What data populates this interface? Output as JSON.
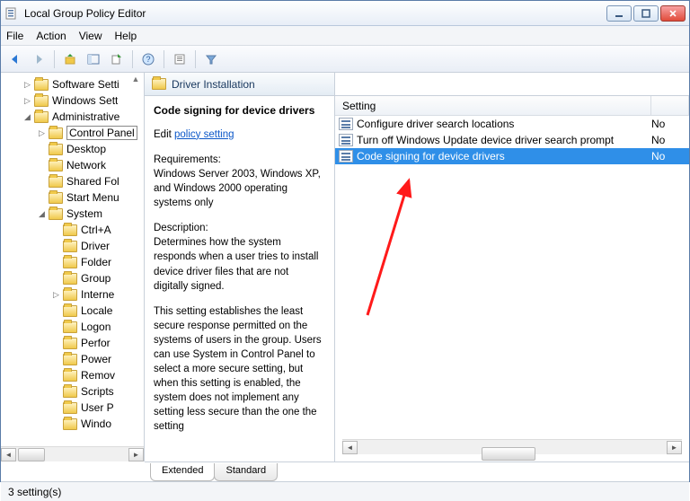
{
  "window": {
    "title": "Local Group Policy Editor"
  },
  "menu": {
    "file": "File",
    "action": "Action",
    "view": "View",
    "help": "Help"
  },
  "tree": {
    "items": [
      {
        "indent": 1,
        "exp": "▷",
        "label": "Software Setti"
      },
      {
        "indent": 1,
        "exp": "▷",
        "label": "Windows Sett"
      },
      {
        "indent": 1,
        "exp": "◢",
        "label": "Administrative"
      },
      {
        "indent": 2,
        "exp": "▷",
        "label": "Control Panel",
        "boxed": true
      },
      {
        "indent": 2,
        "exp": "",
        "label": "Desktop"
      },
      {
        "indent": 2,
        "exp": "",
        "label": "Network"
      },
      {
        "indent": 2,
        "exp": "",
        "label": "Shared Fol"
      },
      {
        "indent": 2,
        "exp": "",
        "label": "Start Menu"
      },
      {
        "indent": 2,
        "exp": "◢",
        "label": "System"
      },
      {
        "indent": 3,
        "exp": "",
        "label": "Ctrl+A"
      },
      {
        "indent": 3,
        "exp": "",
        "label": "Driver "
      },
      {
        "indent": 3,
        "exp": "",
        "label": "Folder"
      },
      {
        "indent": 3,
        "exp": "",
        "label": "Group"
      },
      {
        "indent": 3,
        "exp": "▷",
        "label": "Interne"
      },
      {
        "indent": 3,
        "exp": "",
        "label": "Locale"
      },
      {
        "indent": 3,
        "exp": "",
        "label": "Logon"
      },
      {
        "indent": 3,
        "exp": "",
        "label": "Perfor"
      },
      {
        "indent": 3,
        "exp": "",
        "label": "Power"
      },
      {
        "indent": 3,
        "exp": "",
        "label": "Remov"
      },
      {
        "indent": 3,
        "exp": "",
        "label": "Scripts"
      },
      {
        "indent": 3,
        "exp": "",
        "label": "User P"
      },
      {
        "indent": 3,
        "exp": "",
        "label": "Windo"
      }
    ]
  },
  "middle": {
    "folder_title": "Driver Installation",
    "setting_title": "Code signing for device drivers",
    "edit_prefix": "Edit ",
    "edit_link": "policy setting",
    "requirements_label": "Requirements:",
    "requirements_body": "Windows Server 2003, Windows XP, and Windows 2000 operating systems only",
    "description_label": "Description:",
    "description_body1": "Determines how the system responds when a user tries to install device driver files that are not digitally signed.",
    "description_body2": "This setting establishes the least secure response permitted on the systems of users in the group. Users can use System in Control Panel to select a more secure setting, but when this setting is enabled, the system does not implement any setting less secure than the one the setting"
  },
  "list": {
    "col_setting": "Setting",
    "rows": [
      {
        "label": "Configure driver search locations",
        "state": "No"
      },
      {
        "label": "Turn off Windows Update device driver search prompt",
        "state": "No"
      },
      {
        "label": "Code signing for device drivers",
        "state": "No",
        "selected": true
      }
    ]
  },
  "tabs": {
    "extended": "Extended",
    "standard": "Standard"
  },
  "status": {
    "text": "3 setting(s)"
  }
}
